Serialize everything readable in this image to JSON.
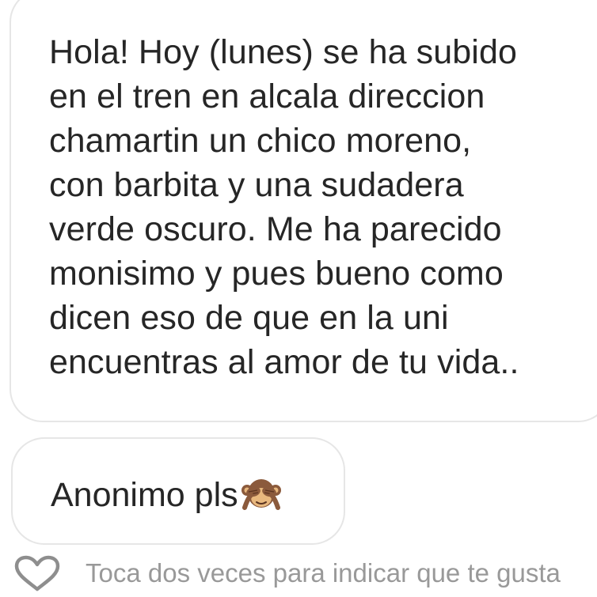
{
  "messages": [
    {
      "text": "Hola! Hoy (lunes) se ha subido\nen el tren en alcala direccion\nchamartin un chico moreno,\ncon barbita y una sudadera\nverde oscuro. Me ha parecido\nmonisimo y pues bueno como\ndicen eso de que en la uni\nencuentras al amor de tu vida.."
    },
    {
      "text": "Anonimo pls",
      "emoji": "see-no-evil-monkey-icon"
    }
  ],
  "footer": {
    "like_icon": "heart-outline-icon",
    "hint": "Toca dos veces para indicar que te gusta"
  },
  "colors": {
    "bubble_border": "#e6e6e6",
    "text": "#262626",
    "hint": "#999999",
    "monkey_fur": "#8b5a3c",
    "monkey_face": "#e8b87e"
  }
}
